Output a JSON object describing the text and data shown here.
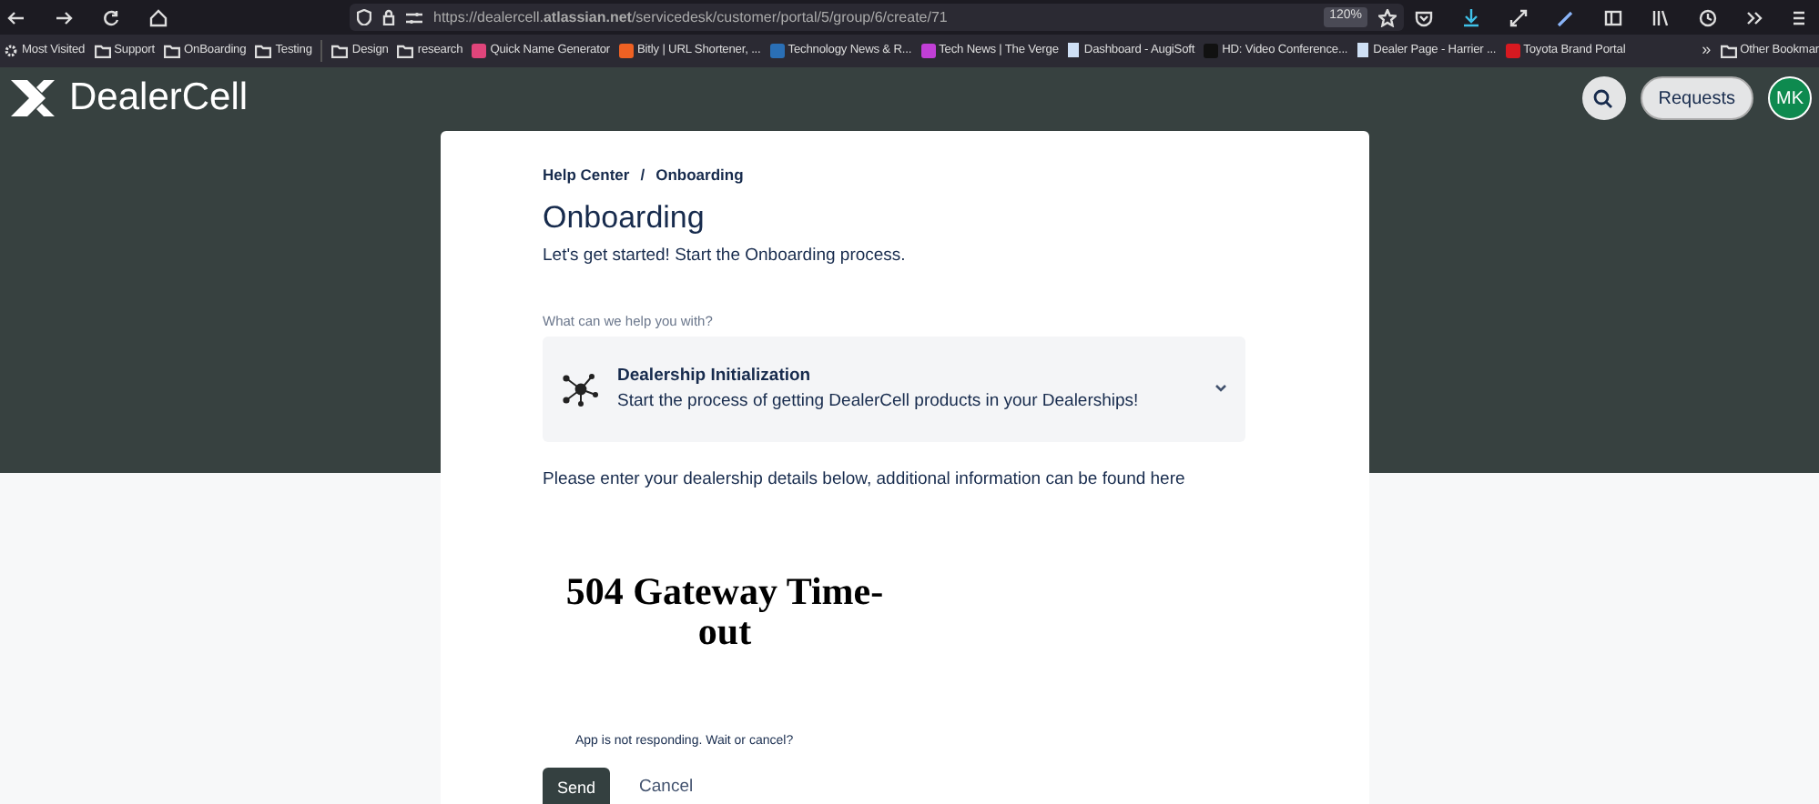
{
  "browser": {
    "url": "https://dealercell.**atlassian.net**/servicedesk/customer/portal/5/group/6/create/71",
    "zoom": "120%",
    "bookmarks": [
      {
        "kind": "gear",
        "label": "Most Visited"
      },
      {
        "kind": "folder",
        "label": "Support"
      },
      {
        "kind": "folder",
        "label": "OnBoarding"
      },
      {
        "kind": "folder",
        "label": "Testing"
      },
      {
        "kind": "separator"
      },
      {
        "kind": "folder",
        "label": "Design"
      },
      {
        "kind": "folder",
        "label": "research"
      },
      {
        "kind": "site",
        "label": "Quick Name Generator",
        "color": "#e0457b"
      },
      {
        "kind": "site",
        "label": "Bitly | URL Shortener, ...",
        "color": "#ee6123"
      },
      {
        "kind": "site",
        "label": "Technology News & R...",
        "color": "#2a6fb5"
      },
      {
        "kind": "site",
        "label": "Tech News | The Verge",
        "color": "#c13fd6"
      },
      {
        "kind": "page",
        "label": "Dashboard - AugiSoft"
      },
      {
        "kind": "site",
        "label": "HD: Video Conference...",
        "color": "#111111"
      },
      {
        "kind": "page",
        "label": "Dealer Page - Harrier ..."
      },
      {
        "kind": "site",
        "label": "Toyota Brand Portal",
        "color": "#d71920"
      }
    ],
    "overflow": "»",
    "other": "Other Bookmar"
  },
  "header": {
    "brand": "DealerCell",
    "requests": "Requests",
    "avatar": "MK"
  },
  "breadcrumb": [
    "Help Center",
    "/",
    "Onboarding"
  ],
  "title": "Onboarding",
  "subtitle": "Let's get started! Start the Onboarding process.",
  "request_type": {
    "label": "What can we help you with?",
    "name": "Dealership Initialization",
    "description": "Start the process of getting DealerCell products in your Dealerships!"
  },
  "instructions": "Please enter your dealership details below, additional information can be found here",
  "embedded": {
    "error": "504 Gateway Time-out",
    "notice": "App is not responding. Wait or cancel?"
  },
  "buttons": {
    "send": "Send",
    "cancel": "Cancel"
  }
}
